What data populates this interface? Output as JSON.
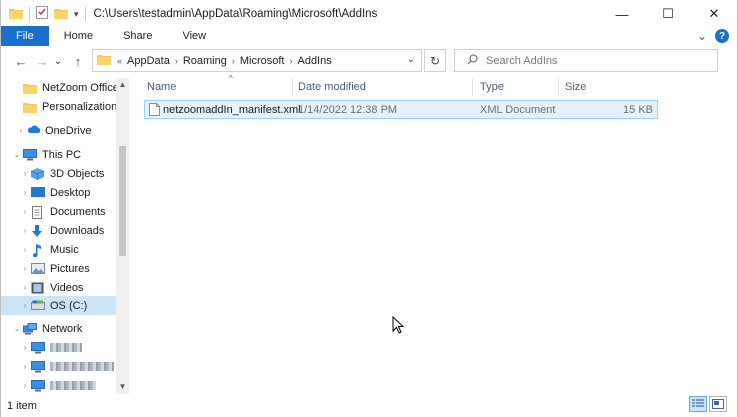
{
  "window": {
    "title": "C:\\Users\\testadmin\\AppData\\Roaming\\Microsoft\\AddIns",
    "controls": {
      "minimize": "—",
      "maximize": "☐",
      "close": "✕"
    }
  },
  "ribbon": {
    "tabs": [
      "File",
      "Home",
      "Share",
      "View"
    ],
    "collapse_glyph": "⌄",
    "help_glyph": "?"
  },
  "navigation": {
    "back": "←",
    "forward": "→",
    "recent": "⌄",
    "up": "↑",
    "breadcrumb_overflow": "«",
    "breadcrumb": [
      "AppData",
      "Roaming",
      "Microsoft",
      "AddIns"
    ],
    "address_dropdown": "⌄",
    "refresh": "↻"
  },
  "search": {
    "placeholder": "Search AddIns"
  },
  "sidebar": {
    "items": [
      {
        "label": "NetZoom Office",
        "icon": "folder-icon"
      },
      {
        "label": "Personalization (",
        "icon": "folder-icon"
      },
      {
        "label": "OneDrive",
        "icon": "cloud-icon"
      },
      {
        "label": "This PC",
        "icon": "computer-icon"
      },
      {
        "label": "3D Objects",
        "icon": "cube-icon"
      },
      {
        "label": "Desktop",
        "icon": "desktop-icon"
      },
      {
        "label": "Documents",
        "icon": "document-icon"
      },
      {
        "label": "Downloads",
        "icon": "download-icon"
      },
      {
        "label": "Music",
        "icon": "music-icon"
      },
      {
        "label": "Pictures",
        "icon": "pictures-icon"
      },
      {
        "label": "Videos",
        "icon": "video-icon"
      },
      {
        "label": "OS (C:)",
        "icon": "drive-icon"
      },
      {
        "label": "Network",
        "icon": "network-icon"
      }
    ]
  },
  "file_list": {
    "columns": [
      "Name",
      "Date modified",
      "Type",
      "Size"
    ],
    "sort_glyph": "^",
    "rows": [
      {
        "name": "netzoomaddIn_manifest.xml",
        "date_modified": "1/14/2022 12:38 PM",
        "type": "XML Document",
        "size": "15 KB"
      }
    ]
  },
  "status": {
    "item_count": "1 item"
  },
  "colors": {
    "accent": "#1a6fcc",
    "folder": "#f3c94f",
    "selection_bg": "#e5f1fb",
    "selection_border": "#99d1ff"
  }
}
